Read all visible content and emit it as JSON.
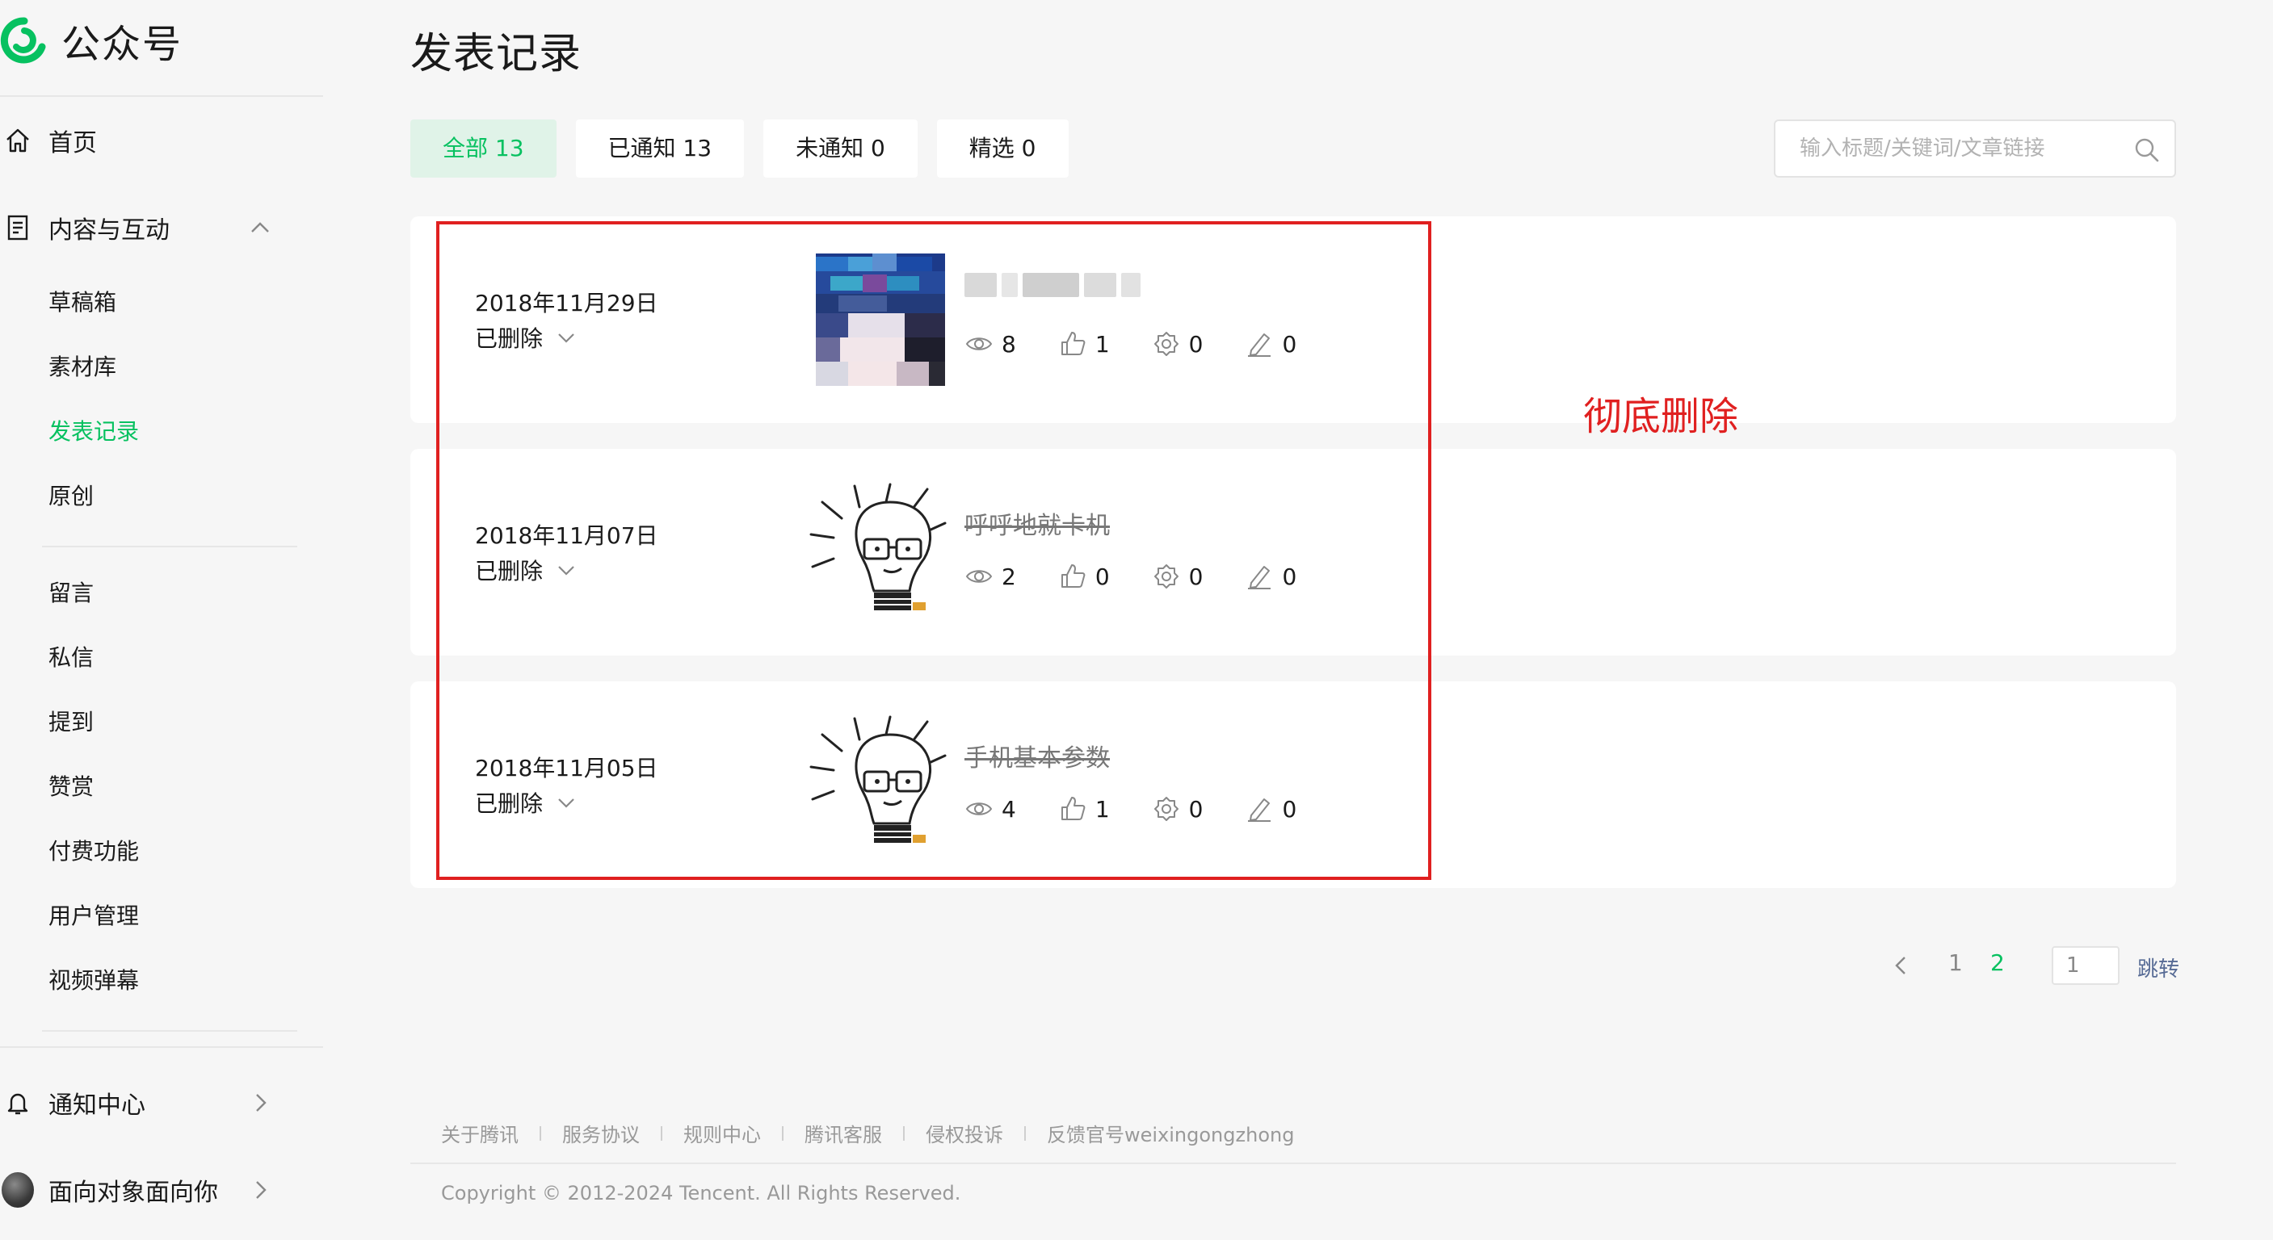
{
  "app": {
    "name": "公众号",
    "brand_color": "#07c160"
  },
  "sidebar": {
    "home": {
      "label": "首页",
      "icon": "home-icon"
    },
    "content_group": {
      "label": "内容与互动",
      "icon": "document-icon",
      "expanded": true
    },
    "content_items": [
      {
        "label": "草稿箱",
        "active": false
      },
      {
        "label": "素材库",
        "active": false
      },
      {
        "label": "发表记录",
        "active": true
      },
      {
        "label": "原创",
        "active": false
      }
    ],
    "interaction_items": [
      {
        "label": "留言"
      },
      {
        "label": "私信"
      },
      {
        "label": "提到"
      },
      {
        "label": "赞赏"
      },
      {
        "label": "付费功能"
      },
      {
        "label": "用户管理"
      },
      {
        "label": "视频弹幕"
      }
    ],
    "notification": {
      "label": "通知中心",
      "icon": "bell-icon"
    },
    "account": {
      "label": "面向对象面向你"
    }
  },
  "main": {
    "title": "发表记录",
    "tabs": [
      {
        "label": "全部 13",
        "active": true
      },
      {
        "label": "已通知 13",
        "active": false
      },
      {
        "label": "未通知 0",
        "active": false
      },
      {
        "label": "精选 0",
        "active": false
      }
    ],
    "search": {
      "placeholder": "输入标题/关键词/文章链接"
    },
    "records": [
      {
        "date": "2018年11月29日",
        "status": "已删除",
        "title": "",
        "title_blurred": true,
        "stats": {
          "views": "8",
          "likes": "1",
          "shares": "0",
          "comments": "0"
        }
      },
      {
        "date": "2018年11月07日",
        "status": "已删除",
        "title": "呼呼地就卡机",
        "title_blurred": false,
        "stats": {
          "views": "2",
          "likes": "0",
          "shares": "0",
          "comments": "0"
        }
      },
      {
        "date": "2018年11月05日",
        "status": "已删除",
        "title": "手机基本参数",
        "title_blurred": false,
        "stats": {
          "views": "4",
          "likes": "1",
          "shares": "0",
          "comments": "0"
        }
      }
    ],
    "annotation": {
      "text": "彻底删除",
      "color": "#e02020"
    },
    "pagination": {
      "pages": [
        "1",
        "2"
      ],
      "current": "2",
      "input_value": "1",
      "jump_label": "跳转"
    }
  },
  "footer": {
    "links": [
      "关于腾讯",
      "服务协议",
      "规则中心",
      "腾讯客服",
      "侵权投诉",
      "反馈官号weixingongzhong"
    ],
    "copyright": "Copyright © 2012-2024 Tencent. All Rights Reserved."
  }
}
